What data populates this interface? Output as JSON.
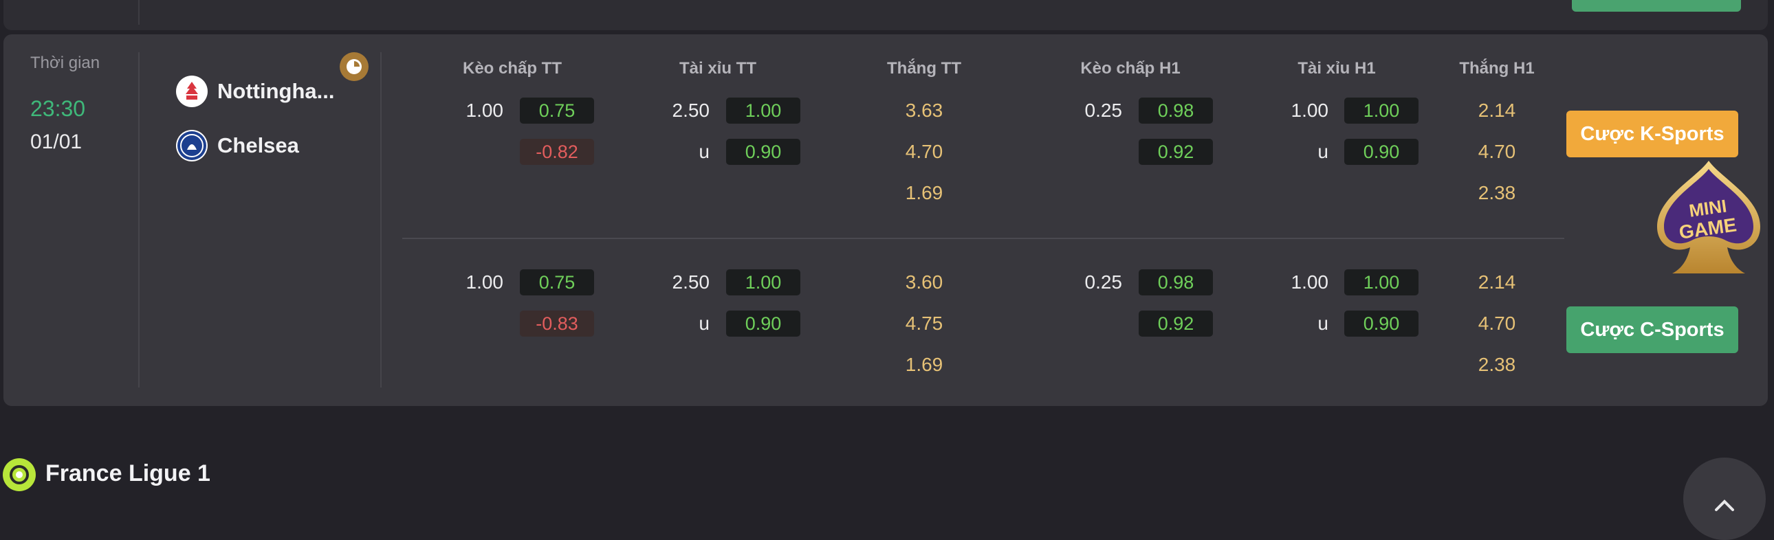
{
  "match": {
    "time_label": "Thời gian",
    "time": "23:30",
    "date": "01/01",
    "home_team": "Nottingha...",
    "away_team": "Chelsea"
  },
  "headers": {
    "keo_chap_tt": "Kèo chấp TT",
    "tai_xiu_tt": "Tài xỉu TT",
    "thang_tt": "Thắng TT",
    "keo_chap_h1": "Kèo chấp H1",
    "tai_xiu_h1": "Tài xỉu H1",
    "thang_h1": "Thắng H1"
  },
  "markets": [
    {
      "hcp_tt": {
        "line": "1.00",
        "home": "0.75",
        "away": "-0.82"
      },
      "ou_tt": {
        "line": "2.50",
        "over": "1.00",
        "under_label": "u",
        "under": "0.90"
      },
      "win_tt": [
        "3.63",
        "4.70",
        "1.69"
      ],
      "hcp_h1": {
        "line": "0.25",
        "home": "0.98",
        "away": "0.92"
      },
      "ou_h1": {
        "line": "1.00",
        "over": "1.00",
        "under_label": "u",
        "under": "0.90"
      },
      "win_h1": [
        "2.14",
        "4.70",
        "2.38"
      ]
    },
    {
      "hcp_tt": {
        "line": "1.00",
        "home": "0.75",
        "away": "-0.83"
      },
      "ou_tt": {
        "line": "2.50",
        "over": "1.00",
        "under_label": "u",
        "under": "0.90"
      },
      "win_tt": [
        "3.60",
        "4.75",
        "1.69"
      ],
      "hcp_h1": {
        "line": "0.25",
        "home": "0.98",
        "away": "0.92"
      },
      "ou_h1": {
        "line": "1.00",
        "over": "1.00",
        "under_label": "u",
        "under": "0.90"
      },
      "win_h1": [
        "2.14",
        "4.70",
        "2.38"
      ]
    }
  ],
  "buttons": {
    "k_sports": "Cược K-Sports",
    "c_sports": "Cược C-Sports"
  },
  "minigame": {
    "line1": "MINI",
    "line2": "GAME"
  },
  "league": {
    "name": "France Ligue 1"
  },
  "colors": {
    "positive_odds": "#6fcf5a",
    "negative_odds": "#e25d5d",
    "win_odds": "#e6c176",
    "k_sports": "#f1a93b",
    "c_sports": "#46a36d",
    "time": "#3fb87a"
  },
  "icons": {
    "clock": "clock-icon",
    "home_logo": "nottingham-forest-logo",
    "away_logo": "chelsea-logo",
    "league": "ligue1-icon",
    "scroll": "chevron-up-icon"
  }
}
